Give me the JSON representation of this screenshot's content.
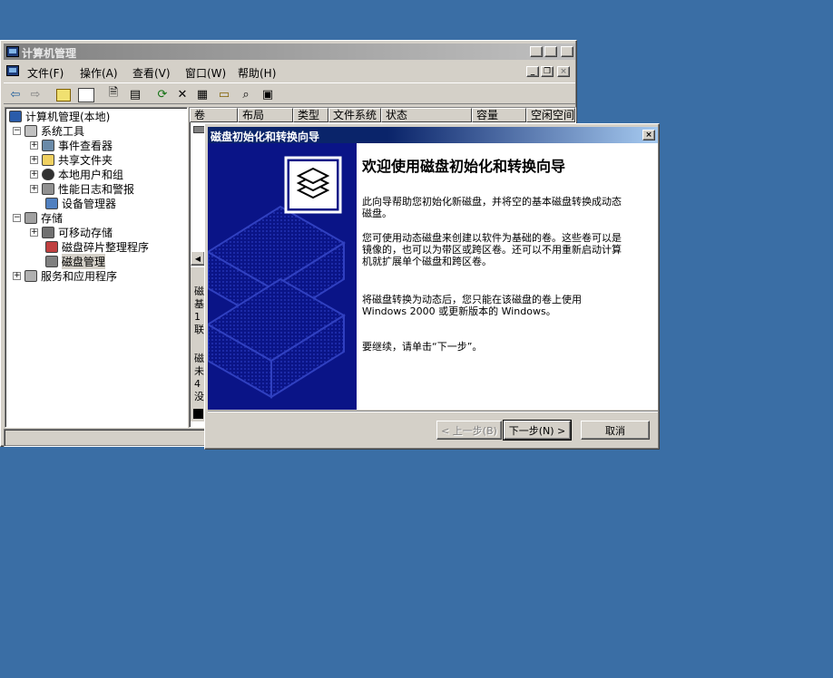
{
  "main_window": {
    "title": "计算机管理",
    "menu": [
      "文件(F)",
      "操作(A)",
      "查看(V)",
      "窗口(W)",
      "帮助(H)"
    ],
    "tree": [
      {
        "label": "计算机管理(本地)",
        "level": 0,
        "expander": ""
      },
      {
        "label": "系统工具",
        "level": 1,
        "expander": "−"
      },
      {
        "label": "事件查看器",
        "level": 2,
        "expander": "+"
      },
      {
        "label": "共享文件夹",
        "level": 2,
        "expander": "+"
      },
      {
        "label": "本地用户和组",
        "level": 2,
        "expander": "+"
      },
      {
        "label": "性能日志和警报",
        "level": 2,
        "expander": "+"
      },
      {
        "label": "设备管理器",
        "level": 2,
        "expander": ""
      },
      {
        "label": "存储",
        "level": 1,
        "expander": "−"
      },
      {
        "label": "可移动存储",
        "level": 2,
        "expander": "+"
      },
      {
        "label": "磁盘碎片整理程序",
        "level": 2,
        "expander": ""
      },
      {
        "label": "磁盘管理",
        "level": 2,
        "expander": ""
      },
      {
        "label": "服务和应用程序",
        "level": 1,
        "expander": "+"
      }
    ],
    "columns": [
      "卷",
      "布局",
      "类型",
      "文件系统",
      "状态",
      "容量",
      "空闲空间"
    ],
    "disk_rows": [
      {
        "l1": "磁",
        "l2": "基",
        "l3": "1",
        "l4": "联"
      },
      {
        "l1": "磁",
        "l2": "未",
        "l3": "4",
        "l4": "没"
      }
    ]
  },
  "wizard": {
    "title": "磁盘初始化和转换向导",
    "heading": "欢迎使用磁盘初始化和转换向导",
    "para1": "此向导帮助您初始化新磁盘，并将空的基本磁盘转换成动态磁盘。",
    "para2": "您可使用动态磁盘来创建以软件为基础的卷。这些卷可以是镜像的，也可以为带区或跨区卷。还可以不用重新启动计算机就扩展单个磁盘和跨区卷。",
    "para3": "将磁盘转换为动态后，您只能在该磁盘的卷上使用 Windows 2000 或更新版本的 Windows。",
    "para4": "要继续，请单击“下一步”。",
    "back_label": "< 上一步(B)",
    "next_label": "下一步(N) >",
    "cancel_label": "取消"
  },
  "colors": {
    "desktop": "#3a6ea5",
    "active_title": "#0a246a",
    "inactive_title": "#808080",
    "banner": "#0a1487"
  }
}
